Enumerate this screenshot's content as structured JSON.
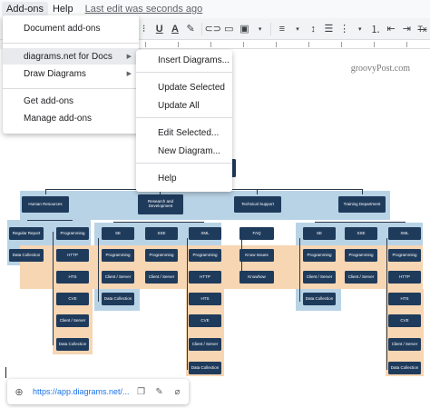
{
  "menubar": {
    "addons": "Add-ons",
    "help": "Help",
    "last_edit": "Last edit was seconds ago"
  },
  "toolbar": {
    "icons": [
      "underline-icon",
      "text-color-icon",
      "highlight-icon",
      "link-icon",
      "comment-icon",
      "image-icon",
      "align-icon",
      "line-spacing-icon",
      "checklist-icon",
      "bulleted-list-icon",
      "numbered-list-icon",
      "indent-decrease-icon",
      "indent-increase-icon",
      "clear-formatting-icon"
    ],
    "underline": "U",
    "text_color": "A",
    "clear_formatting": "Tx"
  },
  "addons_menu": {
    "document_addons": "Document add-ons",
    "diagrams_net": "diagrams.net for Docs",
    "draw_diagrams": "Draw Diagrams",
    "get_addons": "Get add-ons",
    "manage_addons": "Manage add-ons"
  },
  "submenu": {
    "insert": "Insert Diagrams...",
    "update_selected": "Update Selected",
    "update_all": "Update All",
    "edit_selected": "Edit Selected...",
    "new_diagram": "New Diagram...",
    "help": "Help"
  },
  "watermark": "groovyPost.com",
  "orgchart": {
    "top": [
      "Human Resources",
      "Research and Development",
      "Technical Support",
      "Training Department"
    ],
    "hr_left": [
      "Regular Report",
      "Data Collection"
    ],
    "hr_right": [
      "Programming",
      "HTTP",
      "HTS",
      "CVE",
      "Client / Server",
      "Data Collection"
    ],
    "rd_col1": [
      "SE",
      "Programming",
      "Client / Server",
      "Data Collection"
    ],
    "rd_col2": [
      "SSE",
      "Programming",
      "Client / Server"
    ],
    "rd_col3": [
      "XML",
      "Programming",
      "HTTP",
      "HTS",
      "CVE",
      "Client / Server",
      "Data Collection"
    ],
    "ts_col": [
      "FAQ",
      "Know Issues",
      "Knowhow"
    ],
    "tr_col1": [
      "SE",
      "Programming",
      "Client / Server",
      "Data Collection"
    ],
    "tr_col2": [
      "SSE",
      "Programming",
      "Client / Server"
    ],
    "tr_col3": [
      "XML",
      "Programming",
      "HTTP",
      "HTS",
      "CVE",
      "Client / Server",
      "Data Collection"
    ]
  },
  "link_chip": {
    "url": "https://app.diagrams.net/..."
  },
  "colors": {
    "node": "#1f3b5c",
    "band_blue": "#b9d3e6",
    "band_orange": "#f7d6b3",
    "link": "#1a73e8"
  }
}
